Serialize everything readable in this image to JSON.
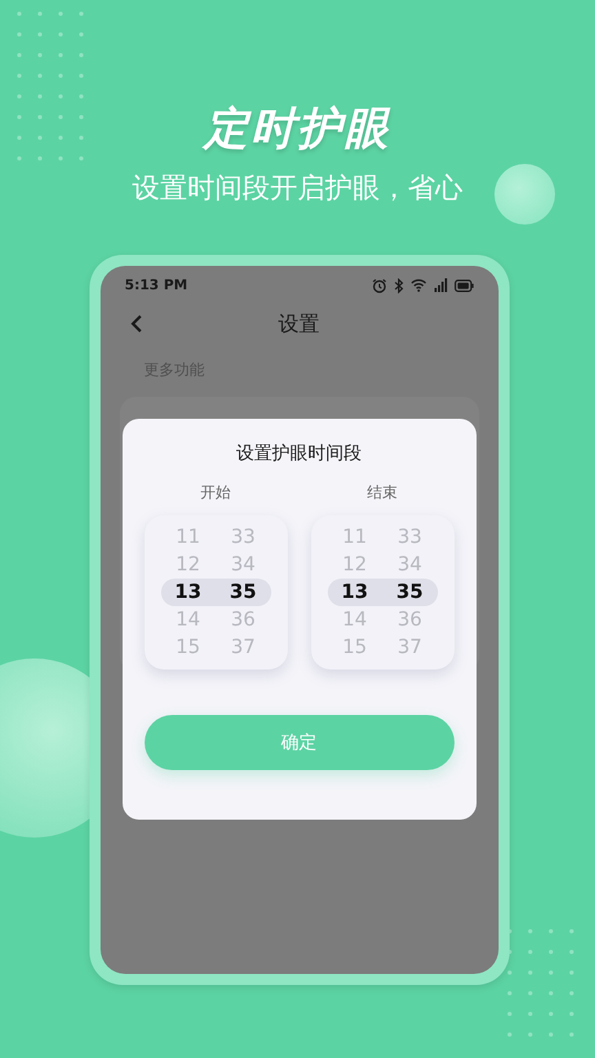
{
  "headline": "定时护眼",
  "subheadline": "设置时间段开启护眼，省心",
  "phone": {
    "status_bar": {
      "time": "5:13 PM"
    },
    "header": {
      "title": "设置"
    },
    "section_label": "更多功能",
    "dialog": {
      "title": "设置护眼时间段",
      "pickers": [
        {
          "label": "开始",
          "rows": [
            {
              "hour": "11",
              "minute": "33",
              "selected": false
            },
            {
              "hour": "12",
              "minute": "34",
              "selected": false
            },
            {
              "hour": "13",
              "minute": "35",
              "selected": true
            },
            {
              "hour": "14",
              "minute": "36",
              "selected": false
            },
            {
              "hour": "15",
              "minute": "37",
              "selected": false
            }
          ]
        },
        {
          "label": "结束",
          "rows": [
            {
              "hour": "11",
              "minute": "33",
              "selected": false
            },
            {
              "hour": "12",
              "minute": "34",
              "selected": false
            },
            {
              "hour": "13",
              "minute": "35",
              "selected": true
            },
            {
              "hour": "14",
              "minute": "36",
              "selected": false
            },
            {
              "hour": "15",
              "minute": "37",
              "selected": false
            }
          ]
        }
      ],
      "confirm_button": "确定"
    }
  }
}
